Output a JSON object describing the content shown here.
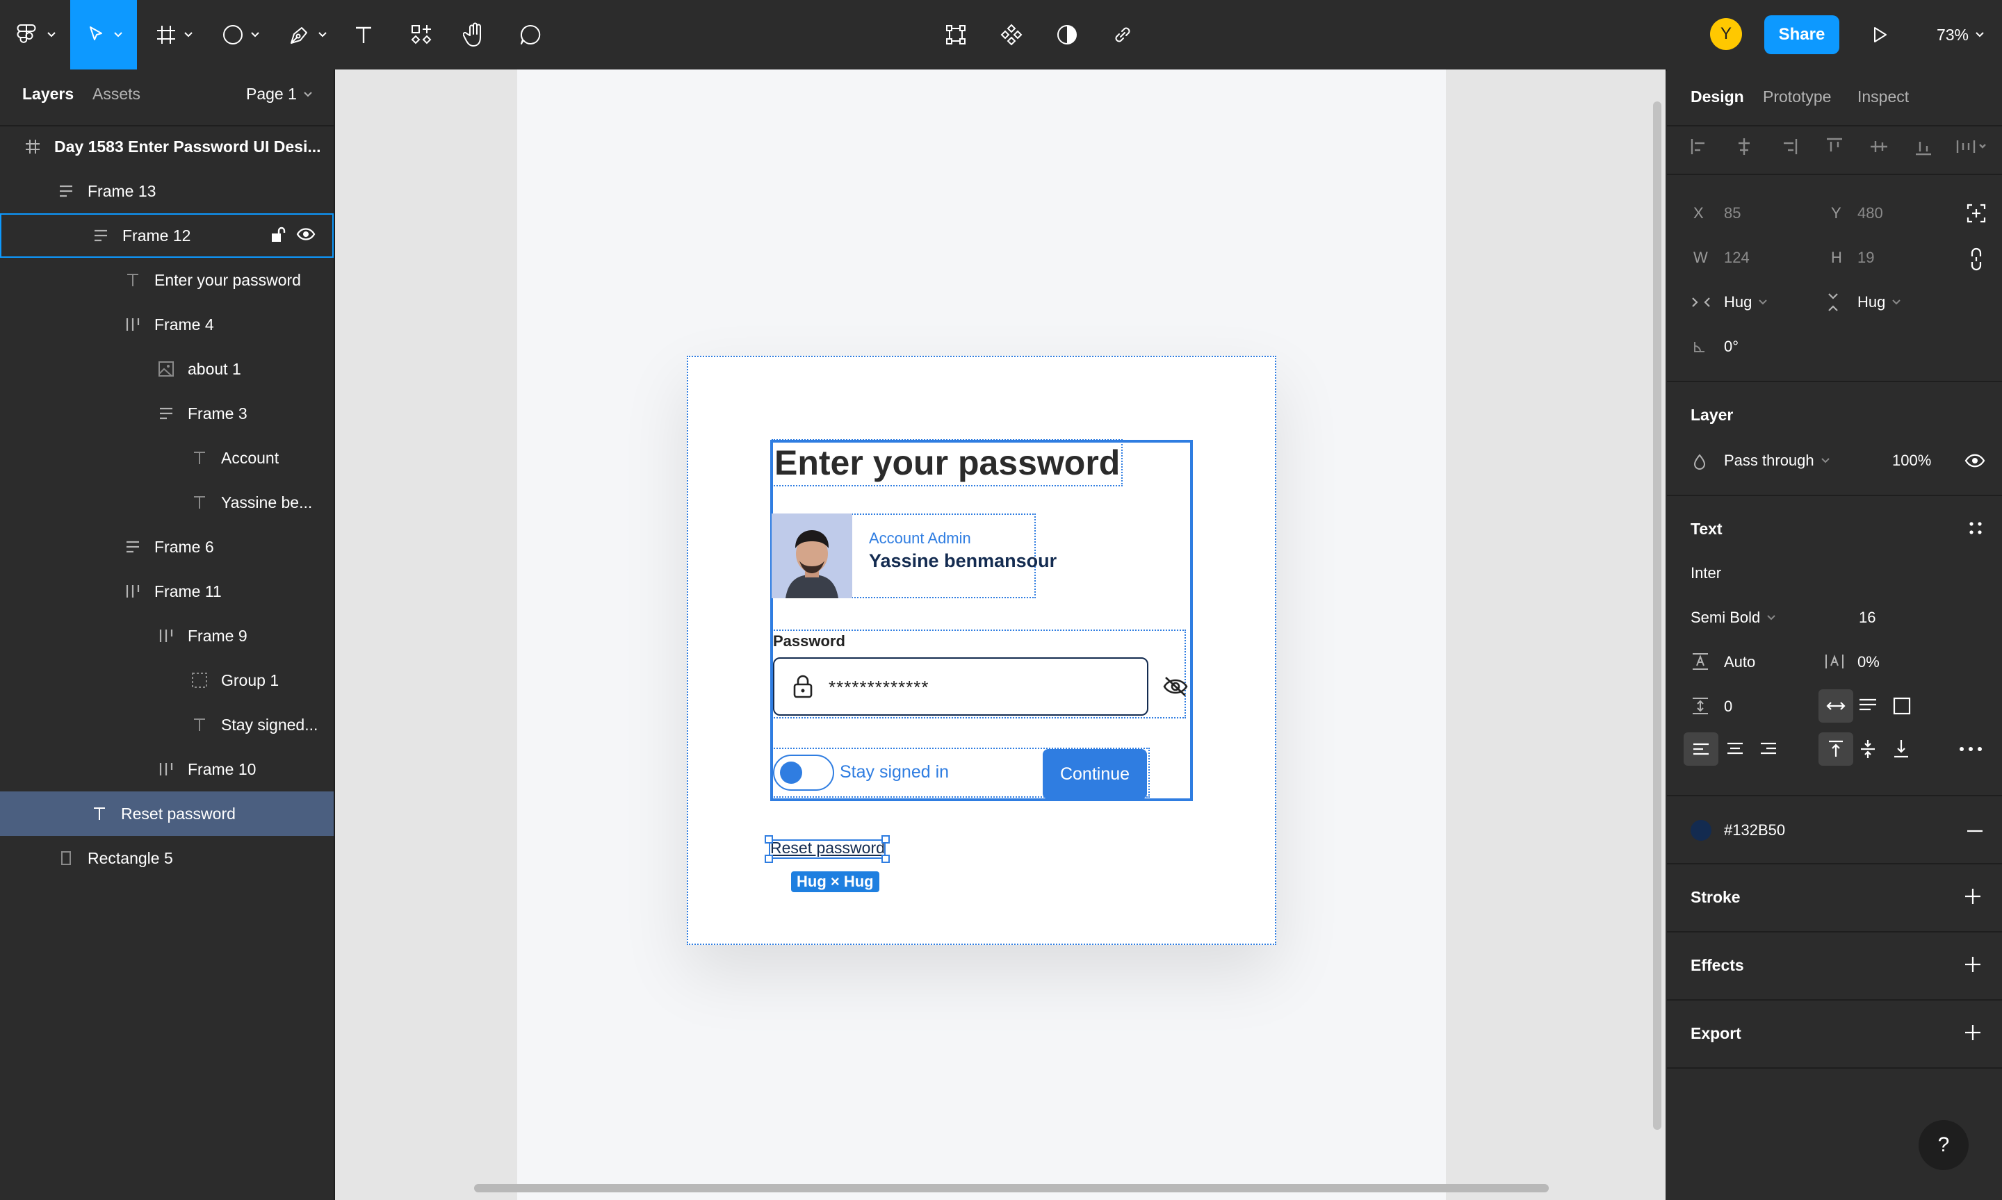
{
  "toolbar": {
    "share_label": "Share",
    "avatar_initial": "Y",
    "zoom": "73%",
    "accent": "#0d99ff"
  },
  "left_panel": {
    "tabs": [
      "Layers",
      "Assets"
    ],
    "page": "Page 1",
    "layers": [
      {
        "name": "Day 1583 Enter Password UI Desi...",
        "icon": "frame-icon"
      },
      {
        "name": "Frame 13",
        "icon": "auto-layout-vertical-icon"
      },
      {
        "name": "Frame 12",
        "icon": "auto-layout-vertical-icon"
      },
      {
        "name": "Enter your password",
        "icon": "text-icon"
      },
      {
        "name": "Frame 4",
        "icon": "auto-layout-horizontal-icon"
      },
      {
        "name": "about 1",
        "icon": "image-icon"
      },
      {
        "name": "Frame 3",
        "icon": "auto-layout-vertical-icon"
      },
      {
        "name": "Account",
        "icon": "text-icon"
      },
      {
        "name": "Yassine be...",
        "icon": "text-icon"
      },
      {
        "name": "Frame 6",
        "icon": "auto-layout-vertical-icon"
      },
      {
        "name": "Frame 11",
        "icon": "auto-layout-horizontal-icon"
      },
      {
        "name": "Frame 9",
        "icon": "auto-layout-horizontal-icon"
      },
      {
        "name": "Group 1",
        "icon": "group-icon"
      },
      {
        "name": "Stay signed...",
        "icon": "text-icon"
      },
      {
        "name": "Frame 10",
        "icon": "auto-layout-horizontal-icon"
      },
      {
        "name": "Reset password",
        "icon": "text-icon"
      },
      {
        "name": "Rectangle 5",
        "icon": "rectangle-icon"
      }
    ]
  },
  "design": {
    "heading": "Enter your password",
    "role": "Account Admin",
    "user_name": "Yassine benmansour",
    "password_label": "Password",
    "password_mask": "*************",
    "stay_signed": "Stay signed in",
    "continue_label": "Continue",
    "reset_label": "Reset password",
    "size_badge": "Hug × Hug",
    "primary_color": "#2f7de1"
  },
  "right_panel": {
    "tabs": [
      "Design",
      "Prototype",
      "Inspect"
    ],
    "x_label": "X",
    "x": "85",
    "y_label": "Y",
    "y": "480",
    "w_label": "W",
    "w": "124",
    "h_label": "H",
    "h": "19",
    "width_mode": "Hug",
    "height_mode": "Hug",
    "rotation": "0°",
    "layer_title": "Layer",
    "blend": "Pass through",
    "opacity": "100%",
    "text_title": "Text",
    "font": "Inter",
    "weight": "Semi Bold",
    "size": "16",
    "line_height": "Auto",
    "letter_spacing": "0%",
    "paragraph_spacing": "0",
    "fill_hex": "#132B50",
    "stroke_title": "Stroke",
    "effects_title": "Effects",
    "export_title": "Export"
  }
}
